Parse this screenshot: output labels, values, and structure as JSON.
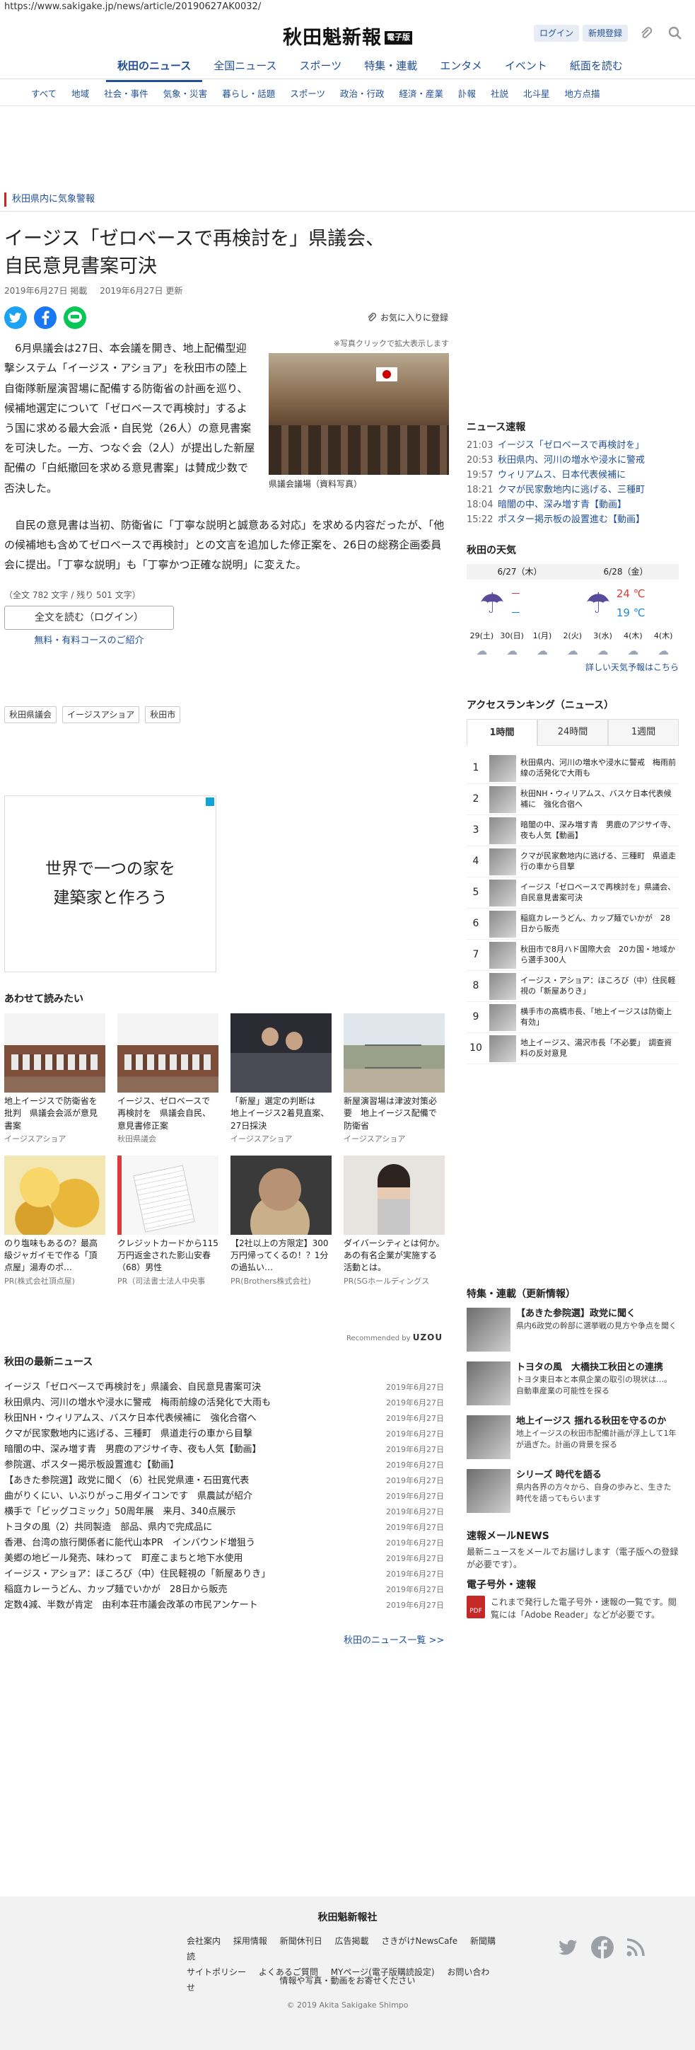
{
  "url": "https://www.sakigake.jp/news/article/20190627AK0032/",
  "header": {
    "logo_text": "秋田魁新報",
    "logo_badge": "電子版",
    "login_label": "ログイン",
    "register_label": "新規登録"
  },
  "nav_main": [
    "秋田のニュース",
    "全国ニュース",
    "スポーツ",
    "特集・連載",
    "エンタメ",
    "イベント",
    "紙面を読む"
  ],
  "nav_sub": [
    "すべて",
    "地域",
    "社会・事件",
    "気象・災害",
    "暮らし・話題",
    "スポーツ",
    "政治・行政",
    "経済・産業",
    "訃報",
    "社説",
    "北斗星",
    "地方点描"
  ],
  "alert": "秋田県内に気象警報",
  "article": {
    "headline_l1": "イージス「ゼロベースで再検討を」県議会、",
    "headline_l2": "自民意見書案可決",
    "published": "2019年6月27日 掲載",
    "updated": "2019年6月27日 更新",
    "favorite_label": "お気に入りに登録",
    "photo_note": "※写真クリックで拡大表示します",
    "photo_caption": "県議会議場（資料写真）",
    "p1": "6月県議会は27日、本会議を開き、地上配備型迎撃システム「イージス・アショア」を秋田市の陸上自衛隊新屋演習場に配備する防衛省の計画を巡り、候補地選定について「ゼロベースで再検討」するよう国に求める最大会派・自民党（26人）の意見書案を可決した。一方、つなぐ会（2人）が提出した新屋配備の「白紙撤回を求める意見書案」は賛成少数で否決した。",
    "p2": "自民の意見書は当初、防衛省に「丁寧な説明と誠意ある対応」を求める内容だったが、「他の候補地も含めてゼロベースで再検討」との文言を追加した修正案を、26日の総務企画委員会に提出。「丁寧な説明」も「丁寧かつ正確な説明」に変えた。",
    "char_count": "（全文 782 文字 / 残り 501 文字）",
    "read_full": "全文を読む（ログイン）",
    "plans": "無料・有料コースのご紹介",
    "tags": [
      "秋田県議会",
      "イージスアショア",
      "秋田市"
    ]
  },
  "ad": {
    "line1": "世界で一つの家を",
    "line2": "建築家と作ろう"
  },
  "also_read": {
    "title": "あわせて読みたい",
    "cards": [
      {
        "title": "地上イージスで防衛省を批判　県議会会派が意見書案",
        "source": "イージスアショア"
      },
      {
        "title": "イージス、ゼロベースで再検討を　県議会自民、意見書修正案",
        "source": "秋田県議会"
      },
      {
        "title": "「新屋」選定の判断は　地上イージス2着見直案、27日採決",
        "source": "イージスアショア"
      },
      {
        "title": "新屋演習場は津波対策必要　地上イージス配備で防衛省",
        "source": "イージスアショア"
      },
      {
        "title": "のり塩味もあるの？最高級ジャガイモで作る「頂点屋」湯寿のポ…",
        "source": "PR(株式会社頂点屋)"
      },
      {
        "title": "クレジットカードから115万円返金された影山安春（68）男性",
        "source": "PR（司法書士法人中央事"
      },
      {
        "title": "【2社以上の方限定】300万円帰ってくるの！？1分の過払い…",
        "source": "PR(Brothers株式会社)"
      },
      {
        "title": "ダイバーシティとは何か。あの有名企業が実施する活動とは。",
        "source": "PR(SGホールディングス"
      }
    ],
    "recommended_label": "Recommended by",
    "recommended_brand": "UZOU"
  },
  "latest": {
    "title": "秋田の最新ニュース",
    "items": [
      {
        "t": "イージス「ゼロベースで再検討を」県議会、自民意見書案可決",
        "d": "2019年6月27日"
      },
      {
        "t": "秋田県内、河川の増水や浸水に警戒　梅雨前線の活発化で大雨も",
        "d": "2019年6月27日"
      },
      {
        "t": "秋田NH・ウィリアムス、バスケ日本代表候補に　強化合宿へ",
        "d": "2019年6月27日"
      },
      {
        "t": "クマが民家敷地内に逃げる、三種町　県道走行の車から目撃",
        "d": "2019年6月27日"
      },
      {
        "t": "暗闇の中、深み増す青　男鹿のアジサイ寺、夜も人気【動画】",
        "d": "2019年6月27日"
      },
      {
        "t": "参院選、ポスター掲示板設置進む【動画】",
        "d": "2019年6月27日"
      },
      {
        "t": "【あきた参院選】政党に聞く（6）社民党県連・石田寛代表",
        "d": "2019年6月27日"
      },
      {
        "t": "曲がりくにい、いぶりがっこ用ダイコンです　県農試が紹介",
        "d": "2019年6月27日"
      },
      {
        "t": "横手で「ビッグコミック」50周年展　来月、340点展示",
        "d": "2019年6月27日"
      },
      {
        "t": "トヨタの風（2）共同製造　部品、県内で完成品に",
        "d": "2019年6月27日"
      },
      {
        "t": "香港、台湾の旅行関係者に能代山本PR　インバウンド増狙う",
        "d": "2019年6月27日"
      },
      {
        "t": "美郷の地ビール発売、味わって　町産こまちと地下水使用",
        "d": "2019年6月27日"
      },
      {
        "t": "イージス・アショア：ほころび（中）住民軽視の「新屋ありき」",
        "d": "2019年6月27日"
      },
      {
        "t": "稲庭カレーうどん、カップ麺でいかが　28日から販売",
        "d": "2019年6月27日"
      },
      {
        "t": "定数4減、半数が肯定　由利本荘市議会改革の市民アンケート",
        "d": "2019年6月27日"
      }
    ],
    "more": "秋田のニュース一覧 >>"
  },
  "sidebar": {
    "news_title": "ニュース速報",
    "news": [
      {
        "tm": "21:03",
        "tx": "イージス「ゼロベースで再検討を」"
      },
      {
        "tm": "20:53",
        "tx": "秋田県内、河川の増水や浸水に警戒"
      },
      {
        "tm": "19:57",
        "tx": "ウィリアムス、日本代表候補に"
      },
      {
        "tm": "18:21",
        "tx": "クマが民家敷地内に逃げる、三種町"
      },
      {
        "tm": "18:04",
        "tx": "暗闇の中、深み増す青【動画】"
      },
      {
        "tm": "15:22",
        "tx": "ポスター掲示板の設置進む【動画】"
      }
    ],
    "weather_title": "秋田の天気",
    "weather_days": [
      {
        "label": "6/27（木）",
        "hi": "－",
        "lo": "－"
      },
      {
        "label": "6/28（金）",
        "hi": "24 ℃",
        "lo": "19 ℃"
      }
    ],
    "weather_week": [
      "29(土)",
      "30(日)",
      "1(月)",
      "2(火)",
      "3(水)",
      "4(木)"
    ],
    "weather_more": "詳しい天気予報はこちら",
    "ranking_title": "アクセスランキング（ニュース）",
    "ranking_tabs": [
      "1時間",
      "24時間",
      "1週間"
    ],
    "ranking": [
      "秋田県内、河川の増水や浸水に警戒　梅雨前線の活発化で大雨も",
      "秋田NH・ウィリアムス、バスケ日本代表候補に　強化合宿へ",
      "暗闇の中、深み増す青　男鹿のアジサイ寺、夜も人気【動画】",
      "クマが民家敷地内に逃げる、三種町　県道走行の車から目撃",
      "イージス「ゼロベースで再検討を」県議会、自民意見書案可決",
      "稲庭カレーうどん、カップ麺でいかが　28日から販売",
      "秋田市で8月ハド国際大会　20カ国・地域から選手300人",
      "イージス・アショア：ほころび（中）住民軽視の「新屋ありき」",
      "横手市の高橋市長、「地上イージスは防衛上有効」",
      "地上イージス、湯沢市長「不必要」　調查資料の反対意見"
    ],
    "features_title": "特集・連載（更新情報）",
    "features": [
      {
        "h": "【あきた参院選】政党に聞く",
        "d": "県内6政党の幹部に選挙戦の見方や争点を聞く"
      },
      {
        "h": "トヨタの風　大橋抉工秋田との連携",
        "d": "トヨタ東日本と本県企業の取引の現状は…。自動車産業の可能性を探る"
      },
      {
        "h": "地上イージス 揺れる秋田を守るのか",
        "d": "地上イージスの秋田市配備計画が浮上して1年が過ぎた。計画の背景を探る"
      },
      {
        "h": "シリーズ 時代を語る",
        "d": "県内各界の方々から、自身の歩みと、生きた時代を語ってもらいます"
      }
    ],
    "mail_title": "速報メールNEWS",
    "mail_text": "最新ニュースをメールでお届けします（電子版への登録が必要です）。",
    "epaper_title": "電子号外・速報",
    "epaper_text": "これまで発行した電子号外・速報の一覧です。閲覧には「Adobe Reader」などが必要です。"
  },
  "footer": {
    "name": "秋田魁新報社",
    "links1": [
      "会社案内",
      "採用情報",
      "新聞休刊日",
      "広告掲載",
      "さきがけNewsCafe",
      "新聞購読"
    ],
    "links2": [
      "サイトポリシー",
      "よくあるご質問",
      "MYページ(電子版購読設定)",
      "お問い合わせ"
    ],
    "sub": "情報や写真・動画をお寄せください",
    "copy": "© 2019 Akita Sakigake Shimpo"
  },
  "colors": {
    "link": "#1f4f9a",
    "alert": "#c62828",
    "twitter": "#1da1f2",
    "facebook": "#1877f2",
    "line": "#06c755"
  }
}
